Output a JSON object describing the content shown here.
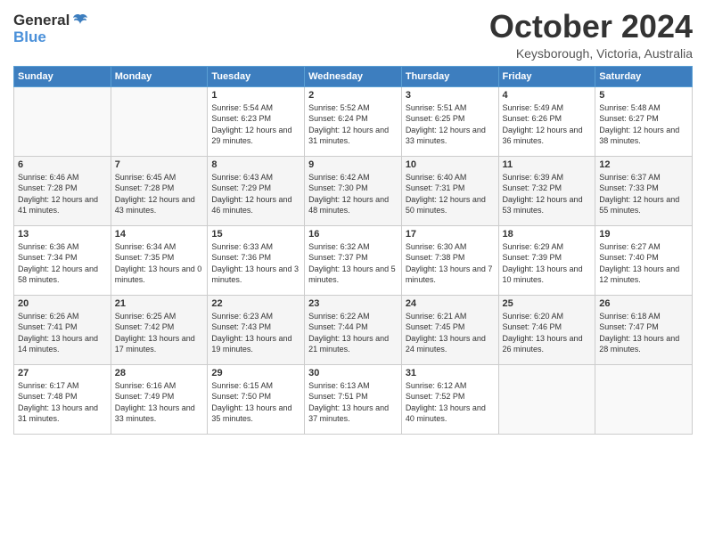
{
  "header": {
    "logo_general": "General",
    "logo_blue": "Blue",
    "month_title": "October 2024",
    "location": "Keysborough, Victoria, Australia"
  },
  "days_of_week": [
    "Sunday",
    "Monday",
    "Tuesday",
    "Wednesday",
    "Thursday",
    "Friday",
    "Saturday"
  ],
  "weeks": [
    [
      {
        "day": "",
        "empty": true
      },
      {
        "day": "",
        "empty": true
      },
      {
        "day": "1",
        "sunrise": "Sunrise: 5:54 AM",
        "sunset": "Sunset: 6:23 PM",
        "daylight": "Daylight: 12 hours and 29 minutes."
      },
      {
        "day": "2",
        "sunrise": "Sunrise: 5:52 AM",
        "sunset": "Sunset: 6:24 PM",
        "daylight": "Daylight: 12 hours and 31 minutes."
      },
      {
        "day": "3",
        "sunrise": "Sunrise: 5:51 AM",
        "sunset": "Sunset: 6:25 PM",
        "daylight": "Daylight: 12 hours and 33 minutes."
      },
      {
        "day": "4",
        "sunrise": "Sunrise: 5:49 AM",
        "sunset": "Sunset: 6:26 PM",
        "daylight": "Daylight: 12 hours and 36 minutes."
      },
      {
        "day": "5",
        "sunrise": "Sunrise: 5:48 AM",
        "sunset": "Sunset: 6:27 PM",
        "daylight": "Daylight: 12 hours and 38 minutes."
      }
    ],
    [
      {
        "day": "6",
        "sunrise": "Sunrise: 6:46 AM",
        "sunset": "Sunset: 7:28 PM",
        "daylight": "Daylight: 12 hours and 41 minutes."
      },
      {
        "day": "7",
        "sunrise": "Sunrise: 6:45 AM",
        "sunset": "Sunset: 7:28 PM",
        "daylight": "Daylight: 12 hours and 43 minutes."
      },
      {
        "day": "8",
        "sunrise": "Sunrise: 6:43 AM",
        "sunset": "Sunset: 7:29 PM",
        "daylight": "Daylight: 12 hours and 46 minutes."
      },
      {
        "day": "9",
        "sunrise": "Sunrise: 6:42 AM",
        "sunset": "Sunset: 7:30 PM",
        "daylight": "Daylight: 12 hours and 48 minutes."
      },
      {
        "day": "10",
        "sunrise": "Sunrise: 6:40 AM",
        "sunset": "Sunset: 7:31 PM",
        "daylight": "Daylight: 12 hours and 50 minutes."
      },
      {
        "day": "11",
        "sunrise": "Sunrise: 6:39 AM",
        "sunset": "Sunset: 7:32 PM",
        "daylight": "Daylight: 12 hours and 53 minutes."
      },
      {
        "day": "12",
        "sunrise": "Sunrise: 6:37 AM",
        "sunset": "Sunset: 7:33 PM",
        "daylight": "Daylight: 12 hours and 55 minutes."
      }
    ],
    [
      {
        "day": "13",
        "sunrise": "Sunrise: 6:36 AM",
        "sunset": "Sunset: 7:34 PM",
        "daylight": "Daylight: 12 hours and 58 minutes."
      },
      {
        "day": "14",
        "sunrise": "Sunrise: 6:34 AM",
        "sunset": "Sunset: 7:35 PM",
        "daylight": "Daylight: 13 hours and 0 minutes."
      },
      {
        "day": "15",
        "sunrise": "Sunrise: 6:33 AM",
        "sunset": "Sunset: 7:36 PM",
        "daylight": "Daylight: 13 hours and 3 minutes."
      },
      {
        "day": "16",
        "sunrise": "Sunrise: 6:32 AM",
        "sunset": "Sunset: 7:37 PM",
        "daylight": "Daylight: 13 hours and 5 minutes."
      },
      {
        "day": "17",
        "sunrise": "Sunrise: 6:30 AM",
        "sunset": "Sunset: 7:38 PM",
        "daylight": "Daylight: 13 hours and 7 minutes."
      },
      {
        "day": "18",
        "sunrise": "Sunrise: 6:29 AM",
        "sunset": "Sunset: 7:39 PM",
        "daylight": "Daylight: 13 hours and 10 minutes."
      },
      {
        "day": "19",
        "sunrise": "Sunrise: 6:27 AM",
        "sunset": "Sunset: 7:40 PM",
        "daylight": "Daylight: 13 hours and 12 minutes."
      }
    ],
    [
      {
        "day": "20",
        "sunrise": "Sunrise: 6:26 AM",
        "sunset": "Sunset: 7:41 PM",
        "daylight": "Daylight: 13 hours and 14 minutes."
      },
      {
        "day": "21",
        "sunrise": "Sunrise: 6:25 AM",
        "sunset": "Sunset: 7:42 PM",
        "daylight": "Daylight: 13 hours and 17 minutes."
      },
      {
        "day": "22",
        "sunrise": "Sunrise: 6:23 AM",
        "sunset": "Sunset: 7:43 PM",
        "daylight": "Daylight: 13 hours and 19 minutes."
      },
      {
        "day": "23",
        "sunrise": "Sunrise: 6:22 AM",
        "sunset": "Sunset: 7:44 PM",
        "daylight": "Daylight: 13 hours and 21 minutes."
      },
      {
        "day": "24",
        "sunrise": "Sunrise: 6:21 AM",
        "sunset": "Sunset: 7:45 PM",
        "daylight": "Daylight: 13 hours and 24 minutes."
      },
      {
        "day": "25",
        "sunrise": "Sunrise: 6:20 AM",
        "sunset": "Sunset: 7:46 PM",
        "daylight": "Daylight: 13 hours and 26 minutes."
      },
      {
        "day": "26",
        "sunrise": "Sunrise: 6:18 AM",
        "sunset": "Sunset: 7:47 PM",
        "daylight": "Daylight: 13 hours and 28 minutes."
      }
    ],
    [
      {
        "day": "27",
        "sunrise": "Sunrise: 6:17 AM",
        "sunset": "Sunset: 7:48 PM",
        "daylight": "Daylight: 13 hours and 31 minutes."
      },
      {
        "day": "28",
        "sunrise": "Sunrise: 6:16 AM",
        "sunset": "Sunset: 7:49 PM",
        "daylight": "Daylight: 13 hours and 33 minutes."
      },
      {
        "day": "29",
        "sunrise": "Sunrise: 6:15 AM",
        "sunset": "Sunset: 7:50 PM",
        "daylight": "Daylight: 13 hours and 35 minutes."
      },
      {
        "day": "30",
        "sunrise": "Sunrise: 6:13 AM",
        "sunset": "Sunset: 7:51 PM",
        "daylight": "Daylight: 13 hours and 37 minutes."
      },
      {
        "day": "31",
        "sunrise": "Sunrise: 6:12 AM",
        "sunset": "Sunset: 7:52 PM",
        "daylight": "Daylight: 13 hours and 40 minutes."
      },
      {
        "day": "",
        "empty": true
      },
      {
        "day": "",
        "empty": true
      }
    ]
  ]
}
